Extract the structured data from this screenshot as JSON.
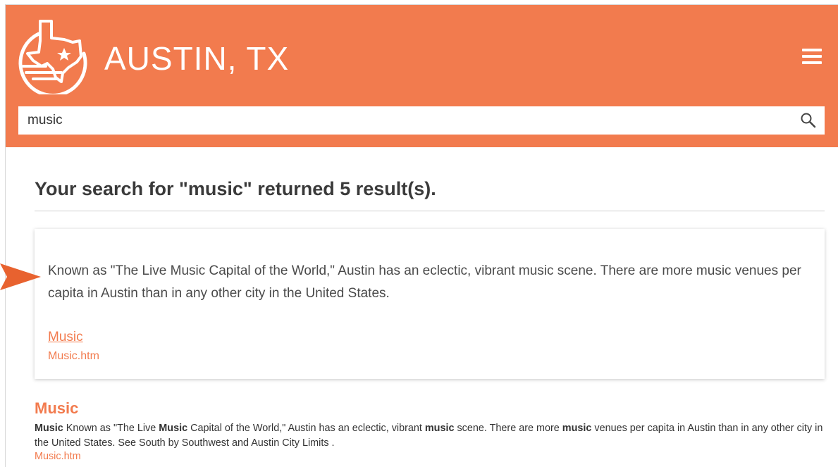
{
  "colors": {
    "brand": "#f27b4e",
    "heading": "#3a3a3a",
    "body_text": "#4a4a4a",
    "link": "#f27b4e"
  },
  "header": {
    "logo_icon": "texas-map-logo",
    "site_title": "AUSTIN, TX",
    "menu_icon": "hamburger-menu-icon"
  },
  "search": {
    "value": "music",
    "icon": "search-icon"
  },
  "results": {
    "heading": "Your search for \"music\" returned 5 result(s).",
    "featured": {
      "text": "Known as \"The Live Music Capital of the World,\" Austin has an eclectic, vibrant music scene. There are more music venues per capita in Austin than in any other city in the United States.",
      "link_label": "Music",
      "url": "Music.htm"
    },
    "items": [
      {
        "title": "Music",
        "snippet_parts": [
          {
            "text": "Music",
            "bold": true
          },
          {
            "text": " Known as \"The Live ",
            "bold": false
          },
          {
            "text": "Music",
            "bold": true
          },
          {
            "text": " Capital of the World,\" Austin has an eclectic, vibrant ",
            "bold": false
          },
          {
            "text": "music",
            "bold": true
          },
          {
            "text": " scene. There are more ",
            "bold": false
          },
          {
            "text": "music",
            "bold": true
          },
          {
            "text": " venues per capita in Austin than in any other city in the United States. See South by Southwest and Austin City Limits .",
            "bold": false
          }
        ],
        "url": "Music.htm"
      }
    ]
  }
}
